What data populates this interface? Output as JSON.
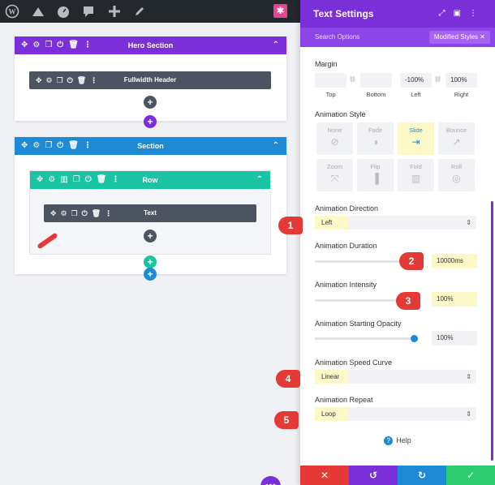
{
  "colors": {
    "purple": "#7b2fd8",
    "blue": "#1e8ad6",
    "teal": "#1ac3a1",
    "dark": "#4b5460",
    "red": "#e53935",
    "green": "#2ecc71",
    "highlight": "#fdf8c8"
  },
  "adminbar": {
    "icons": [
      "wordpress-icon",
      "home-icon",
      "dashboard-icon",
      "comment-icon",
      "plus-icon",
      "edit-icon"
    ]
  },
  "builder": {
    "hero_section": "Hero Section",
    "fullwidth_header": "Fullwidth Header",
    "section": "Section",
    "row": "Row",
    "text_module": "Text"
  },
  "panel": {
    "title": "Text Settings",
    "search_placeholder": "Search Options",
    "filter_label": "Modified Styles",
    "margin_label": "Margin",
    "margin": {
      "top": "",
      "bottom": "",
      "left": "-100%",
      "right": "100%",
      "top_label": "Top",
      "bottom_label": "Bottom",
      "left_label": "Left",
      "right_label": "Right"
    },
    "animation_style_label": "Animation Style",
    "animation_styles": [
      "None",
      "Fade",
      "Slide",
      "Bounce",
      "Zoom",
      "Flip",
      "Fold",
      "Roll"
    ],
    "selected_style": "Slide",
    "direction_label": "Animation Direction",
    "direction_value": "Left",
    "duration_label": "Animation Duration",
    "duration_value": "10000ms",
    "intensity_label": "Animation Intensity",
    "intensity_value": "100%",
    "opacity_label": "Animation Starting Opacity",
    "opacity_value": "100%",
    "opacity_level": 1.0,
    "speed_label": "Animation Speed Curve",
    "speed_value": "Linear",
    "repeat_label": "Animation Repeat",
    "repeat_value": "Loop",
    "help_label": "Help"
  },
  "callouts": [
    "1",
    "2",
    "3",
    "4",
    "5"
  ]
}
